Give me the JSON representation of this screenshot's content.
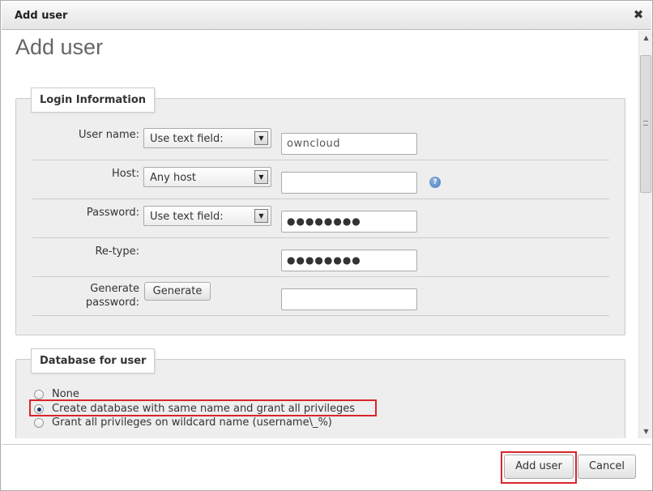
{
  "dialog": {
    "title": "Add user",
    "close_glyph": "✖"
  },
  "heading": "Add user",
  "login_info": {
    "legend": "Login Information",
    "user_name": {
      "label": "User name:",
      "select_value": "Use text field:",
      "input_value": "owncloud"
    },
    "host": {
      "label": "Host:",
      "select_value": "Any host",
      "input_value": "",
      "help_icon": "help-icon"
    },
    "password": {
      "label": "Password:",
      "select_value": "Use text field:",
      "input_value": "●●●●●●●●"
    },
    "retype": {
      "label": "Re-type:",
      "input_value": "●●●●●●●●"
    },
    "generate": {
      "label_line1": "Generate",
      "label_line2": "password:",
      "button": "Generate",
      "input_value": ""
    }
  },
  "database": {
    "legend": "Database for user",
    "options": [
      {
        "label": "None",
        "checked": false
      },
      {
        "label": "Create database with same name and grant all privileges",
        "checked": true
      },
      {
        "label": "Grant all privileges on wildcard name (username\\_%)",
        "checked": false
      }
    ]
  },
  "footer": {
    "add_user": "Add user",
    "cancel": "Cancel"
  },
  "colors": {
    "highlight": "#d9252b",
    "heading": "#666666"
  }
}
